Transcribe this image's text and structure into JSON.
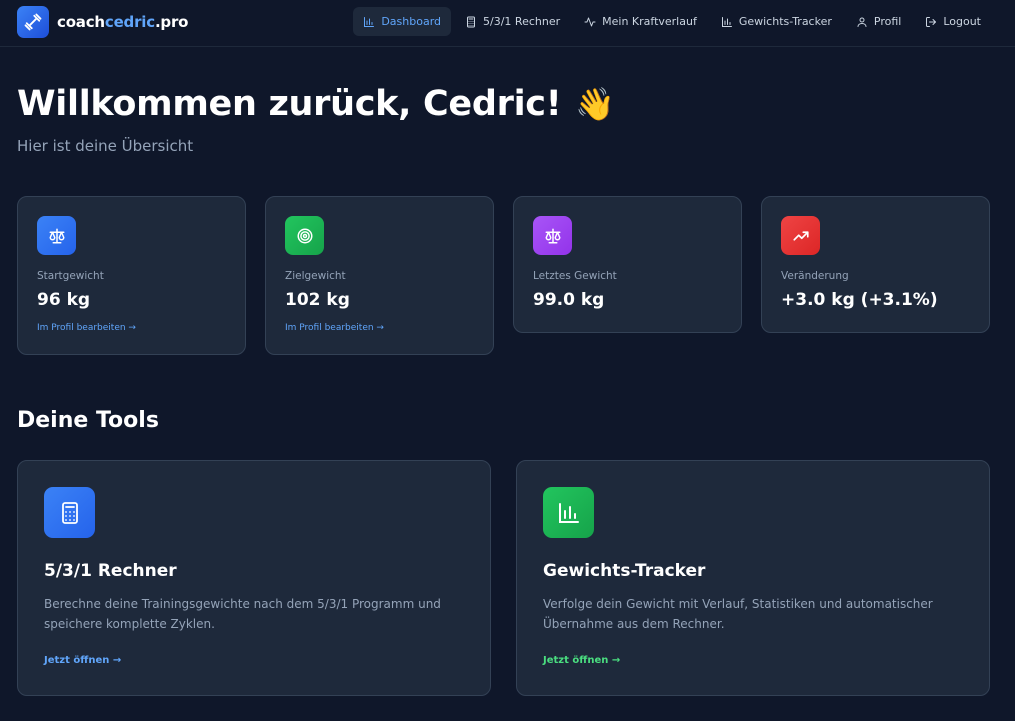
{
  "nav": {
    "logo_prefix": "coach",
    "logo_accent": "cedric",
    "logo_suffix": ".pro",
    "items": [
      {
        "label": "Dashboard",
        "icon": "bar-chart-icon",
        "active": true
      },
      {
        "label": "5/3/1 Rechner",
        "icon": "calculator-icon"
      },
      {
        "label": "Mein Kraftverlauf",
        "icon": "activity-icon"
      },
      {
        "label": "Gewichts-Tracker",
        "icon": "bar-chart-icon"
      },
      {
        "label": "Profil",
        "icon": "user-icon"
      },
      {
        "label": "Logout",
        "icon": "logout-icon"
      }
    ]
  },
  "header": {
    "title": "Willkommen zurück, Cedric!",
    "emoji": "👋",
    "subtitle": "Hier ist deine Übersicht"
  },
  "stats": [
    {
      "label": "Startgewicht",
      "value": "96 kg",
      "link": "Im Profil bearbeiten →",
      "icon": "scale-icon",
      "color": "#3b82f6"
    },
    {
      "label": "Zielgewicht",
      "value": "102 kg",
      "link": "Im Profil bearbeiten →",
      "icon": "target-icon",
      "color": "#22c55e"
    },
    {
      "label": "Letztes Gewicht",
      "value": "99.0 kg",
      "icon": "scale-icon",
      "color": "#a855f7"
    },
    {
      "label": "Veränderung",
      "value": "+3.0 kg (+3.1%)",
      "icon": "trending-up-icon",
      "color": "#ef4444"
    }
  ],
  "tools_section": {
    "title": "Deine Tools",
    "cards": [
      {
        "title": "5/3/1 Rechner",
        "description": "Berechne deine Trainingsgewichte nach dem 5/3/1 Programm und speichere komplette Zyklen.",
        "link": "Jetzt öffnen →",
        "icon": "calculator-icon",
        "color": "#3b82f6",
        "link_color": "#60a5fa"
      },
      {
        "title": "Gewichts-Tracker",
        "description": "Verfolge dein Gewicht mit Verlauf, Statistiken und automatischer Übernahme aus dem Rechner.",
        "link": "Jetzt öffnen →",
        "icon": "bar-chart-icon",
        "color": "#22c55e",
        "link_color": "#4ade80"
      }
    ]
  }
}
